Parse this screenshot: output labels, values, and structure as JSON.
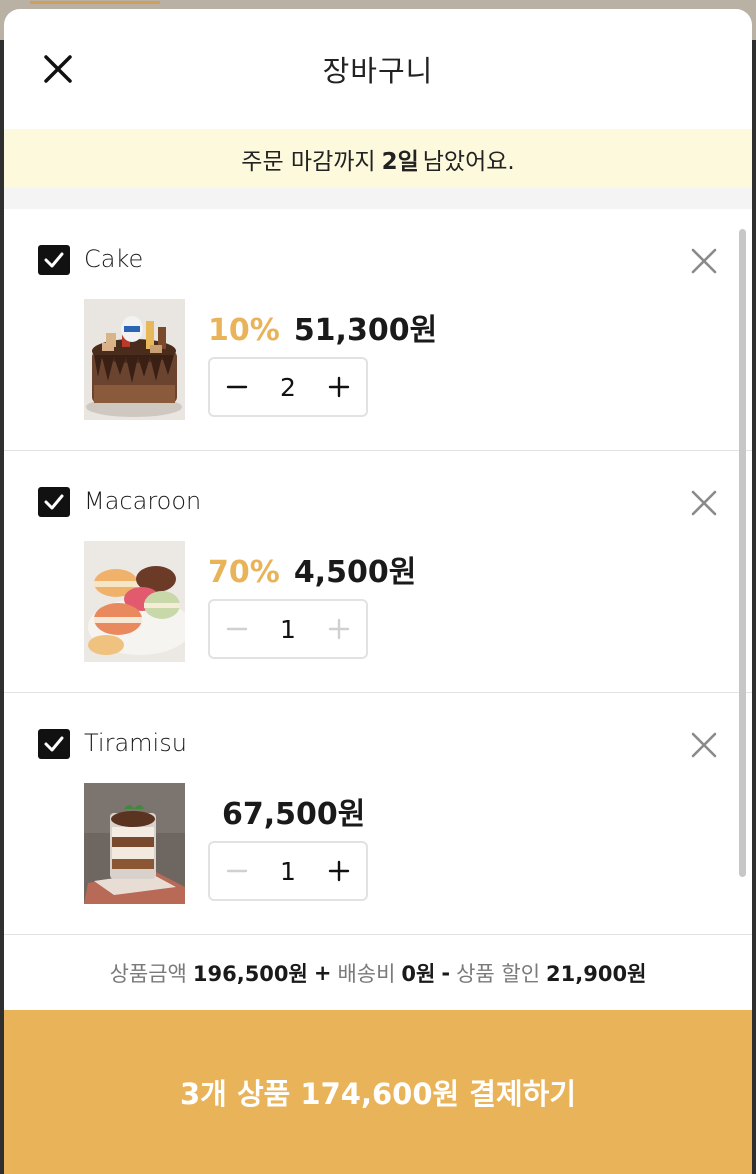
{
  "header": {
    "title": "장바구니"
  },
  "deadline": {
    "prefix": "주문 마감까지",
    "days": "2일",
    "suffix": "남았어요."
  },
  "items": [
    {
      "name": "Cake",
      "checked": true,
      "discount": "10%",
      "price": "51,300원",
      "quantity": "2",
      "minus_enabled": true,
      "plus_enabled": true,
      "image": "cake"
    },
    {
      "name": "Macaroon",
      "checked": true,
      "discount": "70%",
      "price": "4,500원",
      "quantity": "1",
      "minus_enabled": false,
      "plus_enabled": false,
      "image": "macaroon"
    },
    {
      "name": "Tiramisu",
      "checked": true,
      "discount": "",
      "price": "67,500원",
      "quantity": "1",
      "minus_enabled": false,
      "plus_enabled": true,
      "image": "tiramisu"
    }
  ],
  "summary": {
    "product_label": "상품금액",
    "product_amount": "196,500원",
    "plus": "+",
    "shipping_label": "배송비",
    "shipping_amount": "0원",
    "minus": "-",
    "discount_label": "상품 할인",
    "discount_amount": "21,900원"
  },
  "pay_button": {
    "label": "3개 상품 174,600원 결제하기"
  },
  "colors": {
    "accent": "#e9b35a",
    "notice_bg": "#fdf9dc",
    "checkbox": "#111111",
    "disabled": "#d0d0d0"
  },
  "icons": {
    "close": "close-icon",
    "check": "check-icon",
    "remove": "remove-icon",
    "minus": "minus-icon",
    "plus": "plus-icon"
  }
}
